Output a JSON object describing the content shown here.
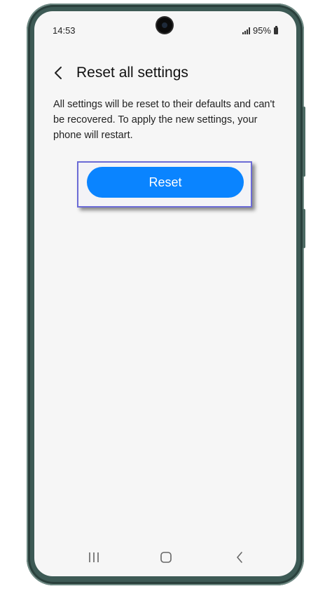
{
  "status_bar": {
    "time": "14:53",
    "battery": "95%"
  },
  "header": {
    "title": "Reset all settings",
    "back_icon": "chevron-left-icon"
  },
  "main": {
    "description": "All settings will be reset to their defaults and can't be recovered. To apply the new settings, your phone will restart.",
    "reset_label": "Reset"
  },
  "colors": {
    "accent": "#0a84ff",
    "highlight_border": "#6b6bd6",
    "background": "#f6f6f6",
    "phone_frame": "#3d5a55"
  },
  "navigation_bar": {
    "icons": [
      "recents-icon",
      "home-icon",
      "back-icon"
    ]
  }
}
